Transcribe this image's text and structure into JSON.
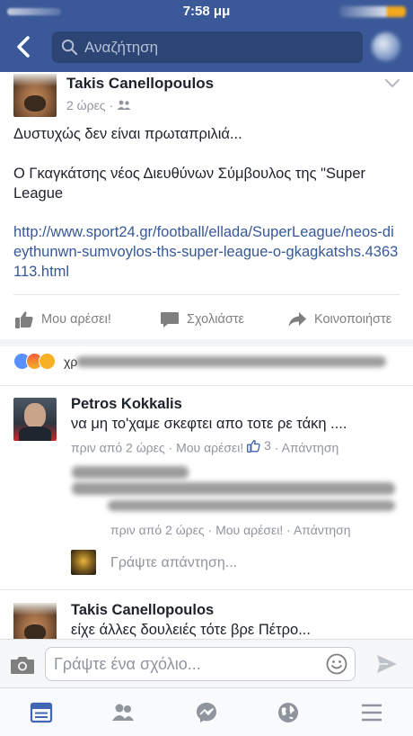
{
  "status_bar": {
    "time": "7:58 μμ"
  },
  "nav": {
    "search_placeholder": "Αναζήτηση"
  },
  "post": {
    "author": "Takis Canellopoulos",
    "time": "2 ώρες",
    "text_line1": "Δυστυχώς δεν είναι πρωταπριλιά...",
    "text_line2": "Ο Γκαγκάτσης νέος Διευθύνων Σύμβουλος της \"Super League",
    "link": "http://www.sport24.gr/football/ellada/SuperLeague/neos-dieythunwn-sumvoylos-ths-super-league-o-gkagkatshs.4363113.html",
    "actions": {
      "like": "Μου αρέσει!",
      "comment": "Σχολιάστε",
      "share": "Κοινοποιήστε"
    }
  },
  "reactions": {
    "names_visible": "χρ"
  },
  "comments": [
    {
      "author": "Petros Kokkalis",
      "text": "να μη το'χαμε σκεφτει απο τοτε ρε τάκη ....",
      "time": "πριν από 2 ώρες",
      "like_label": "Μου αρέσει!",
      "like_count": "3",
      "reply_label": "Απάντηση"
    },
    {
      "author": "Takis Canellopoulos",
      "text": "είχε άλλες δουλειές τότε βρε Πέτρο..."
    }
  ],
  "reply": {
    "time": "πριν από 2 ώρες",
    "like_label": "Μου αρέσει!",
    "reply_label": "Απάντηση",
    "placeholder": "Γράψτε απάντηση..."
  },
  "composer": {
    "placeholder": "Γράψτε ένα σχόλιο..."
  },
  "colors": {
    "brand": "#3b5998",
    "link": "#365899",
    "like_blue": "#4267b2"
  },
  "tabs": [
    "news-feed-icon",
    "friends-icon",
    "messenger-icon",
    "notifications-globe-icon",
    "menu-icon"
  ]
}
